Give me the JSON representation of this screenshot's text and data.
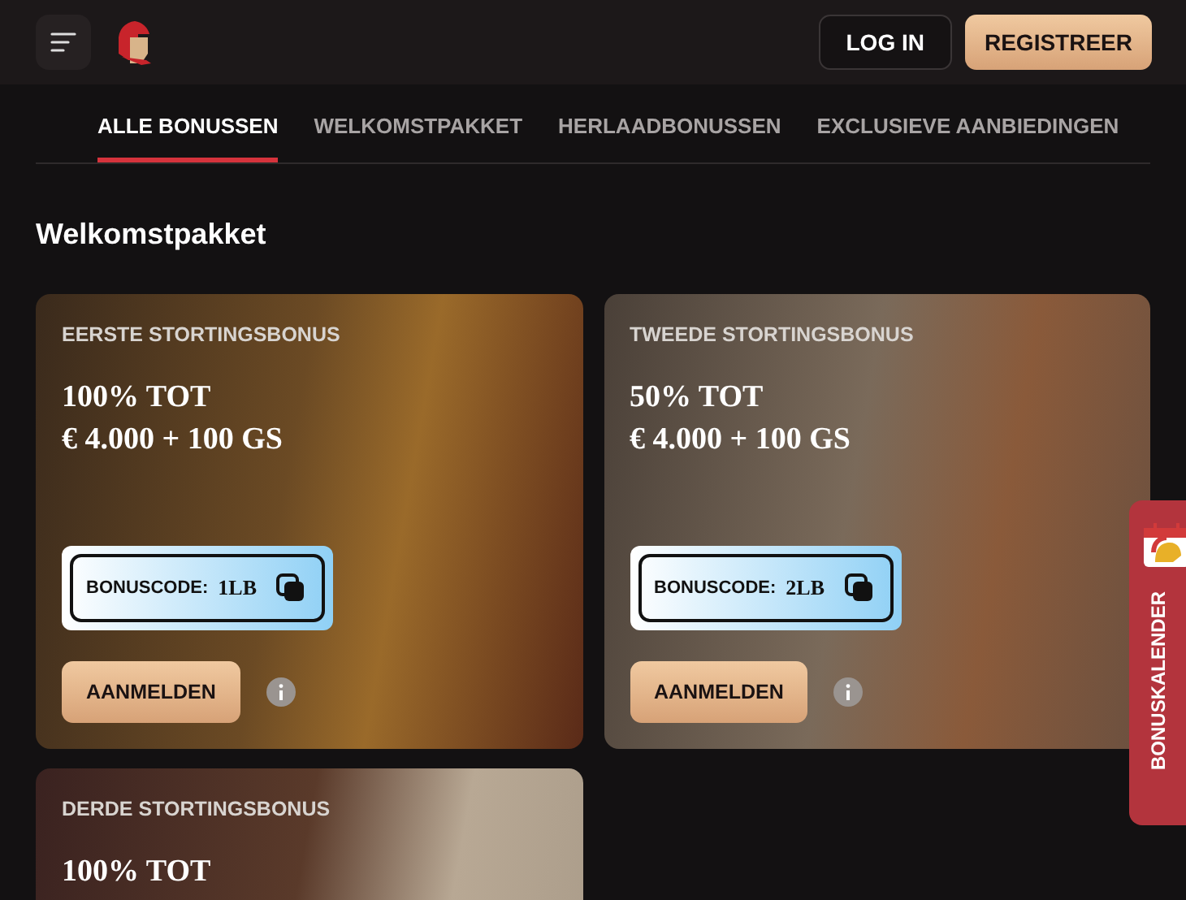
{
  "header": {
    "log_in": "LOG IN",
    "register": "REGISTREER"
  },
  "tabs": [
    {
      "label": "ALLE BONUSSEN",
      "selected": true
    },
    {
      "label": "WELKOMSTPAKKET",
      "selected": false
    },
    {
      "label": "HERLAADBONUSSEN",
      "selected": false
    },
    {
      "label": "EXCLUSIEVE AANBIEDINGEN",
      "selected": false
    }
  ],
  "section_title": "Welkomstpakket",
  "cards": [
    {
      "title": "EERSTE STORTINGSBONUS",
      "headline": [
        "100% TOT",
        "€ 4.000 + 100 GS"
      ],
      "bonus_code_label": "BONUSCODE:",
      "bonus_code": "1LB",
      "button": "AANMELDEN"
    },
    {
      "title": "TWEEDE STORTINGSBONUS",
      "headline": [
        "50% TOT",
        "€ 4.000 + 100 GS"
      ],
      "bonus_code_label": "BONUSCODE:",
      "bonus_code": "2LB",
      "button": "AANMELDEN"
    },
    {
      "title": "DERDE STORTINGSBONUS",
      "headline": [
        "100% TOT"
      ]
    }
  ],
  "side_tab": {
    "label": "BONUSKALENDER"
  }
}
